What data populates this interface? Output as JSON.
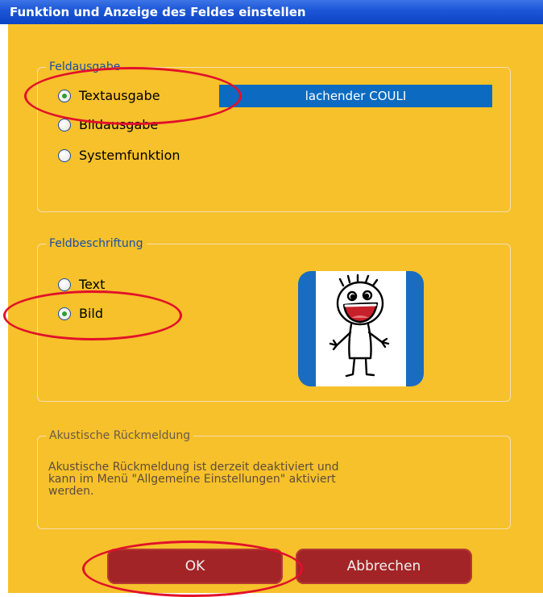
{
  "window": {
    "title": "Funktion und Anzeige des Feldes einstellen"
  },
  "feldausgabe": {
    "legend": "Feldausgabe",
    "options": [
      {
        "label": "Textausgabe",
        "checked": true
      },
      {
        "label": "Bildausgabe",
        "checked": false
      },
      {
        "label": "Systemfunktion",
        "checked": false
      }
    ],
    "text_value": "lachender COULI"
  },
  "feldbeschriftung": {
    "legend": "Feldbeschriftung",
    "options": [
      {
        "label": "Text",
        "checked": false
      },
      {
        "label": "Bild",
        "checked": true
      }
    ]
  },
  "akustisch": {
    "legend": "Akustische Rückmeldung",
    "line1": "Akustische Rückmeldung ist derzeit deaktiviert und",
    "line2": "kann im Menü \"Allgemeine Einstellungen\" aktiviert",
    "line3": "werden."
  },
  "buttons": {
    "ok": "OK",
    "cancel": "Abbrechen"
  },
  "colors": {
    "background": "#f6c12a",
    "highlight": "#e2102a",
    "button": "#a32426",
    "text_box": "#0c6bc0"
  }
}
